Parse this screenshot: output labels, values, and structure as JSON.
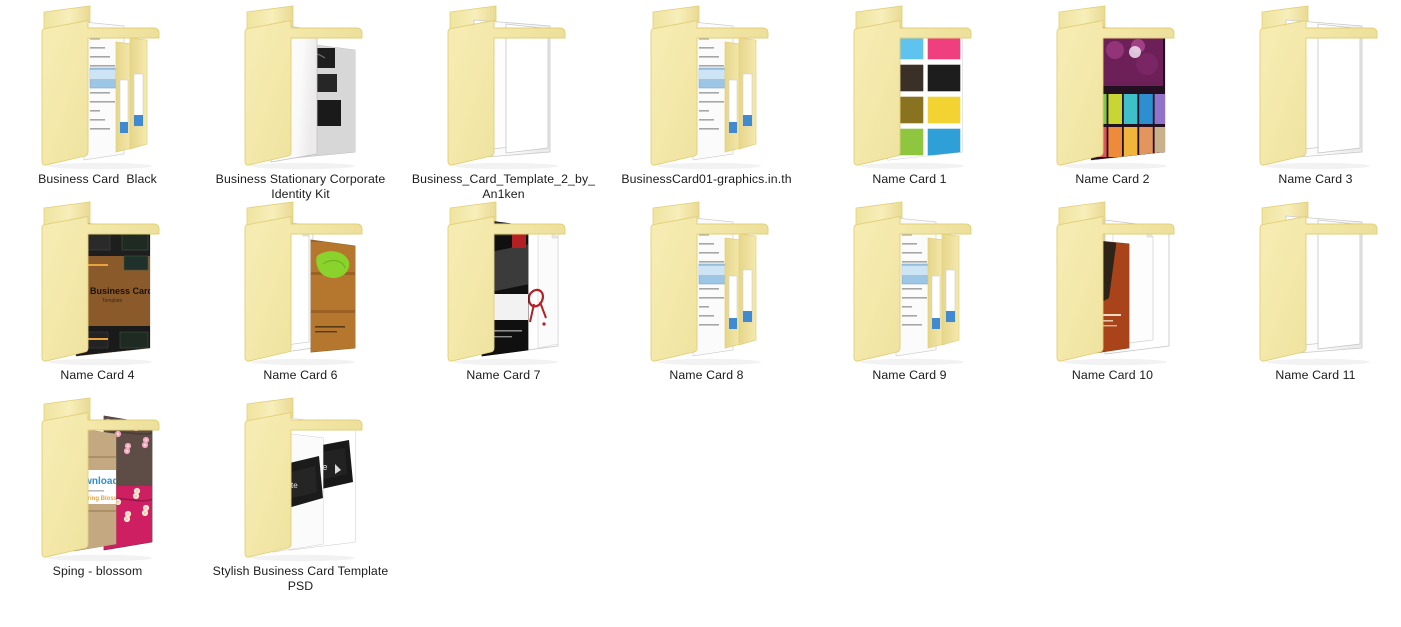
{
  "view": {
    "name": "windows-explorer-large-icons",
    "background_color": "#ffffff",
    "folder_color": "#f3e5a8",
    "folder_edge_color": "#e3cf78",
    "label_color": "#1b1b1b",
    "columns": 7,
    "rows": 3,
    "item_count": 16
  },
  "items": [
    {
      "label": "Business Card  Black",
      "icon": "folder-open-documents-icon",
      "preview": "stacked-white-documents-with-blue-tabs",
      "row": 0,
      "col": 0
    },
    {
      "label": "Business Stationary Corporate Identity Kit",
      "icon": "folder-open-preview-icon",
      "preview": "dark-stationery-mockup-on-halftone-sheet",
      "row": 0,
      "col": 1
    },
    {
      "label": "Business_Card_Template_2_by_An1ken",
      "icon": "folder-open-documents-icon",
      "preview": "blank-white-pages",
      "row": 0,
      "col": 2
    },
    {
      "label": "BusinessCard01-graphics.in.th",
      "icon": "folder-open-documents-icon",
      "preview": "stacked-white-documents-with-blue-tabs",
      "row": 0,
      "col": 3
    },
    {
      "label": "Name Card 1",
      "icon": "folder-open-preview-icon",
      "preview": "grid-of-eight-colorful-business-cards",
      "row": 0,
      "col": 4
    },
    {
      "label": "Name Card 2",
      "icon": "folder-open-preview-icon",
      "preview": "dark-purple-bokeh-card-set",
      "row": 0,
      "col": 5
    },
    {
      "label": "Name Card 3",
      "icon": "folder-open-documents-icon",
      "preview": "blank-white-pages",
      "row": 0,
      "col": 6
    },
    {
      "label": "Name Card 4",
      "icon": "folder-open-preview-icon",
      "preview": "wood-texture-business-card-template",
      "row": 1,
      "col": 0
    },
    {
      "label": "Name Card 6",
      "icon": "folder-open-preview-icon",
      "preview": "green-leaf-on-wood-card",
      "row": 1,
      "col": 1
    },
    {
      "label": "Name Card 7",
      "icon": "folder-open-preview-icon",
      "preview": "black-white-card-with-red-ribbon",
      "row": 1,
      "col": 2
    },
    {
      "label": "Name Card 8",
      "icon": "folder-open-documents-icon",
      "preview": "stacked-white-documents-with-blue-tabs",
      "row": 1,
      "col": 3
    },
    {
      "label": "Name Card 9",
      "icon": "folder-open-documents-icon",
      "preview": "stacked-white-documents-with-blue-tabs",
      "row": 1,
      "col": 4
    },
    {
      "label": "Name Card 10",
      "icon": "folder-open-preview-icon",
      "preview": "brown-orange-portrait-card",
      "row": 1,
      "col": 5
    },
    {
      "label": "Name Card 11",
      "icon": "folder-open-documents-icon",
      "preview": "blank-white-pages",
      "row": 1,
      "col": 6
    },
    {
      "label": "Sping - blossom",
      "icon": "folder-open-preview-icon",
      "preview": "cherry-blossom-cards-brown-and-pink",
      "row": 2,
      "col": 0
    },
    {
      "label": "Stylish Business Card Template PSD",
      "icon": "folder-open-preview-icon",
      "preview": "black-glossy-cards-on-white-sheets",
      "row": 2,
      "col": 1
    }
  ]
}
